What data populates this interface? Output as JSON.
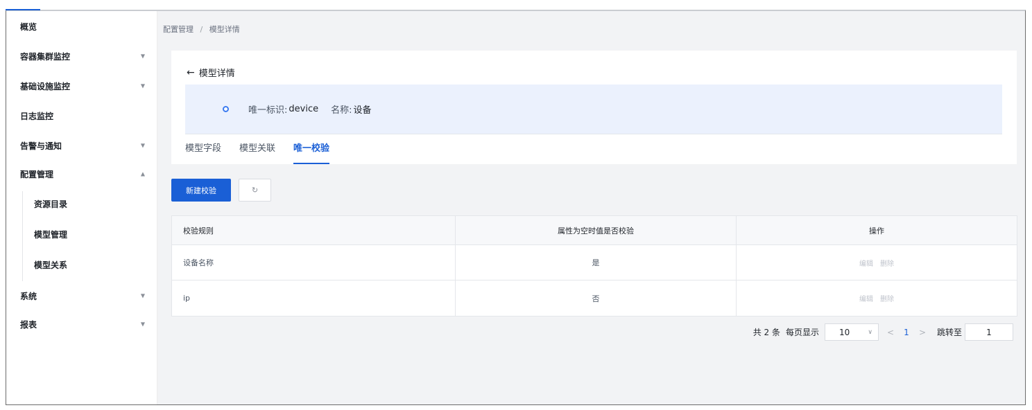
{
  "sidebar": {
    "items": [
      {
        "label": "概览",
        "has_chevron": false
      },
      {
        "label": "容器集群监控",
        "chevron": "▼"
      },
      {
        "label": "基础设施监控",
        "chevron": "▼"
      },
      {
        "label": "日志监控",
        "has_chevron": false
      },
      {
        "label": "告警与通知",
        "chevron": "▼"
      },
      {
        "label": "配置管理",
        "chevron": "▲"
      },
      {
        "label": "系统",
        "chevron": "▼"
      },
      {
        "label": "报表",
        "chevron": "▼"
      }
    ],
    "sub_items": [
      {
        "label": "资源目录"
      },
      {
        "label": "模型管理"
      },
      {
        "label": "模型关系"
      }
    ]
  },
  "breadcrumb": {
    "parent": "配置管理",
    "separator": "/",
    "current": "模型详情"
  },
  "detail": {
    "back_arrow": "←",
    "back_label": "模型详情",
    "id_label": "唯一标识:",
    "id_value": "device",
    "name_label": "名称:",
    "name_value": "设备"
  },
  "tabs": [
    {
      "label": "模型字段",
      "active": false
    },
    {
      "label": "模型关联",
      "active": false
    },
    {
      "label": "唯一校验",
      "active": true
    }
  ],
  "toolbar": {
    "new_label": "新建校验",
    "refresh_icon": "refresh-icon",
    "refresh_glyph": "↻"
  },
  "table": {
    "headers": [
      "校验规则",
      "属性为空时值是否校验",
      "操作"
    ],
    "rows": [
      {
        "rule": "设备名称",
        "check_on_empty": "是",
        "edit": "编辑",
        "delete": "删除"
      },
      {
        "rule": "ip",
        "check_on_empty": "否",
        "edit": "编辑",
        "delete": "删除"
      }
    ]
  },
  "pagination": {
    "total": "共 2 条",
    "per_page_label": "每页显示",
    "per_page": "10",
    "dropdown_glyph": "∨",
    "prev": "<",
    "current": "1",
    "next": ">",
    "jump_label": "跳转至",
    "jump_value": "1"
  },
  "colors": {
    "primary": "#1a5fd6",
    "info_band": "#ebf1fd",
    "content_bg": "#f2f3f5"
  }
}
